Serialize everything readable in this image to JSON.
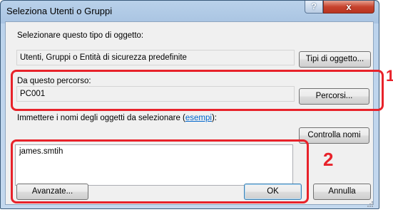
{
  "window": {
    "title": "Seleziona Utenti o Gruppi",
    "help_label": "?",
    "close_label": "x"
  },
  "object_type": {
    "label": "Selezionare questo tipo di oggetto:",
    "value": "Utenti, Gruppi o Entità di sicurezza predefinite",
    "button": "Tipi di oggetto..."
  },
  "location": {
    "label": "Da questo percorso:",
    "value": "PC001",
    "button": "Percorsi..."
  },
  "names": {
    "label": "Immettere i nomi degli oggetti da selezionare",
    "examples_open": " (",
    "examples_link": "esempi",
    "examples_close": "):",
    "value": "james.smtih",
    "check_button": "Controlla nomi"
  },
  "footer": {
    "advanced_button": "Avanzate...",
    "ok_button": "OK",
    "cancel_button": "Annulla"
  },
  "callouts": {
    "one": "1",
    "two": "2"
  },
  "colors": {
    "highlight": "#e8222a"
  }
}
